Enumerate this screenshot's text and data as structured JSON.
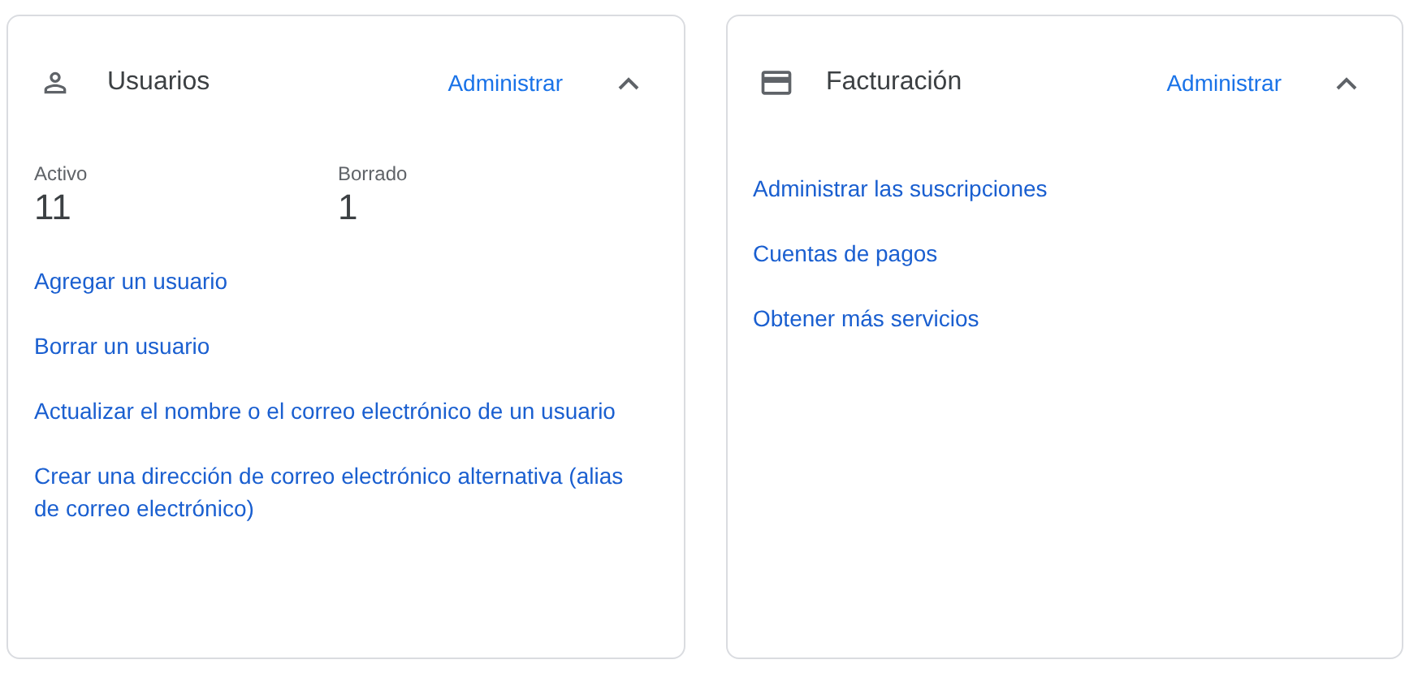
{
  "cards": [
    {
      "kind": "users",
      "title": "Usuarios",
      "action": "Administrar",
      "expanded": true,
      "stats": [
        {
          "label": "Activo",
          "value": "11"
        },
        {
          "label": "Borrado",
          "value": "1"
        }
      ],
      "links": [
        "Agregar un usuario",
        "Borrar un usuario",
        "Actualizar el nombre o el correo electrónico de un usuario",
        "Crear una dirección de correo electrónico alternativa (alias de correo electrónico)"
      ]
    },
    {
      "kind": "billing",
      "title": "Facturación",
      "action": "Administrar",
      "expanded": true,
      "links": [
        "Administrar las suscripciones",
        "Cuentas de pagos",
        "Obtener más servicios"
      ]
    }
  ]
}
